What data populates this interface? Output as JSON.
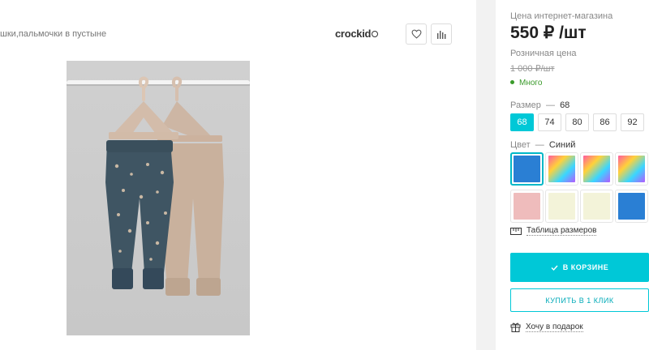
{
  "product": {
    "name": "шки,пальмочки в пустыне",
    "brand": "crockid"
  },
  "pricing": {
    "online_label": "Цена интернет-магазина",
    "price": "550 ₽ /шт",
    "retail_label": "Розничная цена",
    "retail_price": "1 000 ₽/шт",
    "stock": "Много"
  },
  "size": {
    "label": "Размер",
    "dash": "—",
    "selected": "68",
    "options": [
      "68",
      "74",
      "80",
      "86",
      "92"
    ]
  },
  "color": {
    "label": "Цвет",
    "dash": "—",
    "selected": "Синий",
    "swatches": [
      {
        "name": "blue",
        "color": "#2a7fd4"
      },
      {
        "name": "rainbow",
        "color": "rainbow"
      },
      {
        "name": "rainbow",
        "color": "rainbow"
      },
      {
        "name": "rainbow",
        "color": "rainbow"
      },
      {
        "name": "pink",
        "color": "#efbcbc"
      },
      {
        "name": "cream",
        "color": "#f3f3d9"
      },
      {
        "name": "cream",
        "color": "#f3f3d9"
      },
      {
        "name": "blue",
        "color": "#2a7fd4"
      }
    ]
  },
  "links": {
    "size_table": "Таблица размеров",
    "gift": "Хочу в подарок"
  },
  "buttons": {
    "in_cart": "В КОРЗИНЕ",
    "one_click": "КУПИТЬ В 1 КЛИК"
  },
  "icons": [
    "heart-icon",
    "chart-bars-icon",
    "check-icon",
    "ruler-icon",
    "gift-icon"
  ],
  "accent_color": "#00c8d7"
}
